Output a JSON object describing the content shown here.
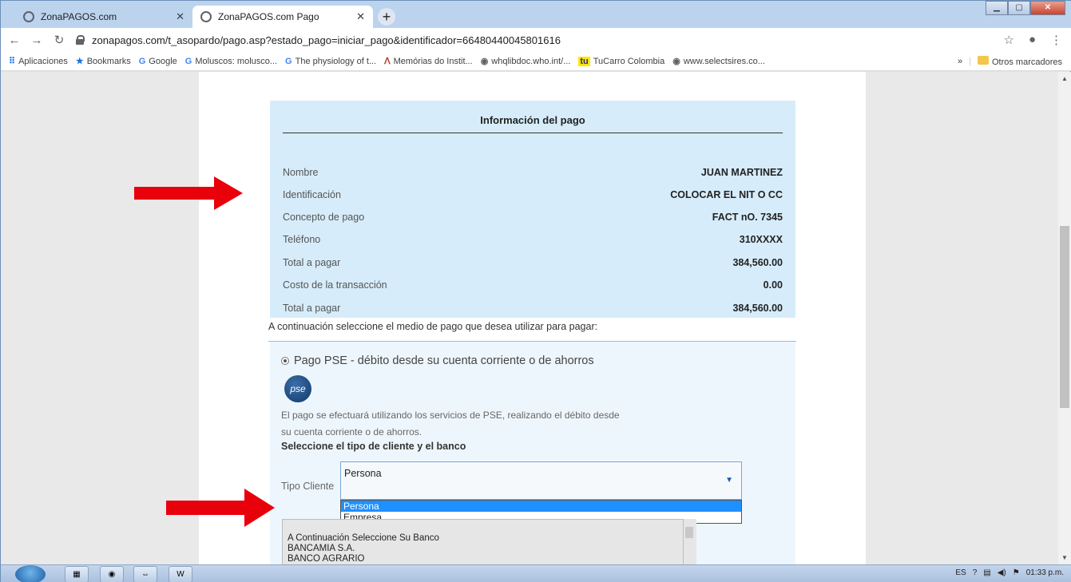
{
  "browser": {
    "tabs": [
      {
        "title": "ZonaPAGOS.com",
        "active": false
      },
      {
        "title": "ZonaPAGOS.com Pago",
        "active": true
      }
    ],
    "url": "zonapagos.com/t_asopardo/pago.asp?estado_pago=iniciar_pago&identificador=66480440045801616",
    "bookmarks": [
      {
        "label": "Aplicaciones",
        "icon": "apps-grid-icon"
      },
      {
        "label": "Bookmarks",
        "icon": "star-icon"
      },
      {
        "label": "Google",
        "icon": "google-icon"
      },
      {
        "label": "Moluscos: molusco...",
        "icon": "google-icon"
      },
      {
        "label": "The physiology of t...",
        "icon": "google-icon"
      },
      {
        "label": "Memórias do Instit...",
        "icon": "signature-icon"
      },
      {
        "label": "whqlibdoc.who.int/...",
        "icon": "globe-icon"
      },
      {
        "label": "TuCarro Colombia",
        "icon": "tucarro-icon"
      },
      {
        "label": "www.selectsires.co...",
        "icon": "globe-icon"
      }
    ],
    "bookmarks_overflow": "»",
    "other_bookmarks": "Otros marcadores"
  },
  "payment_info": {
    "title": "Información del pago",
    "rows": [
      {
        "label": "Nombre",
        "value": "JUAN MARTINEZ"
      },
      {
        "label": "Identificación",
        "value": "COLOCAR EL NIT O CC"
      },
      {
        "label": "Concepto de pago",
        "value": "FACT nO. 7345"
      },
      {
        "label": "Teléfono",
        "value": "310XXXX"
      },
      {
        "label": "Total a pagar",
        "value": "384,560.00"
      },
      {
        "label": "Costo de la transacción",
        "value": "0.00"
      },
      {
        "label": "Total a pagar",
        "value": "384,560.00"
      }
    ]
  },
  "instructions": "A continuación seleccione el medio de pago que desea utilizar para pagar:",
  "pse": {
    "option_label": "Pago PSE - débito desde su cuenta corriente o de ahorros",
    "logo_text": "pse",
    "description_line1": "El pago se efectuará utilizando los servicios de PSE, realizando el débito desde",
    "description_line2": "su cuenta corriente o de ahorros.",
    "select_title": "Seleccione el tipo de cliente y el banco",
    "tipo_cliente_label": "Tipo Cliente",
    "tipo_cliente_value": "Persona",
    "tipo_cliente_options": [
      "Persona",
      "Empresa"
    ],
    "banks": [
      "A Continuación Seleccione Su Banco",
      "BANCAMIA S.A.",
      "BANCO AGRARIO"
    ]
  },
  "taskbar": {
    "language": "ES",
    "clock": "01:33 p.m."
  },
  "colors": {
    "info_bg": "#d6ecfa",
    "pse_bg": "#eef6fd",
    "arrow": "#e8000b",
    "selected_option": "#1e90ff"
  }
}
